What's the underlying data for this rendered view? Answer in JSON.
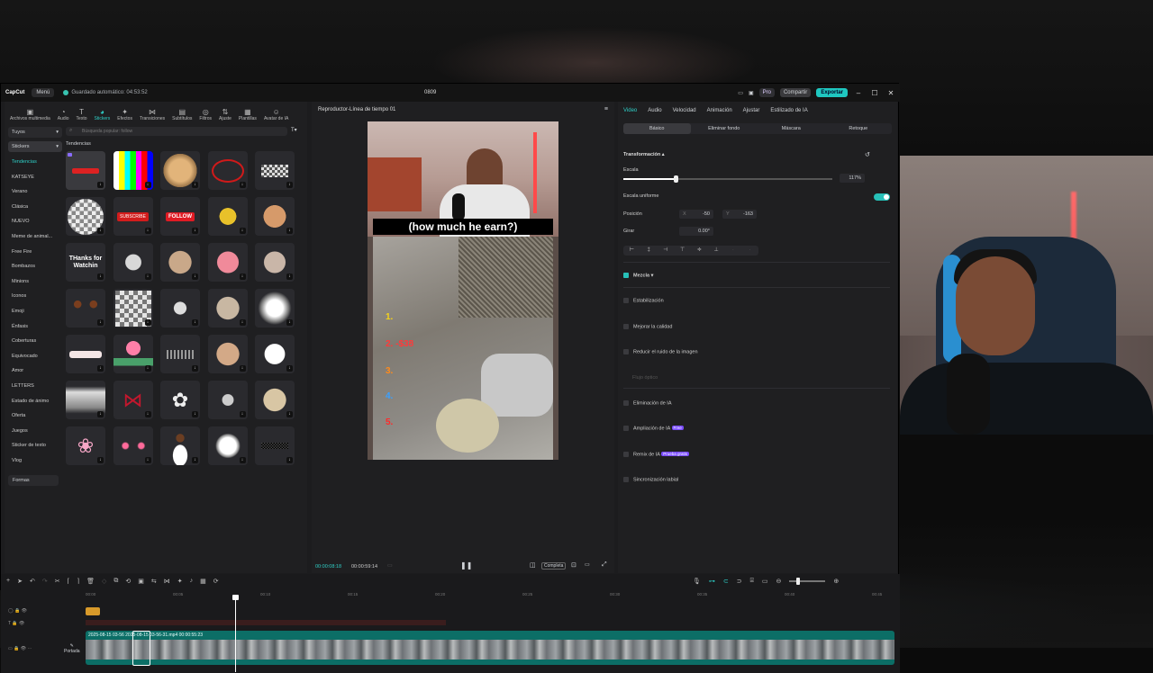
{
  "titlebar": {
    "app": "CapCut",
    "menu": "Menú",
    "autosave": "Guardado automático: 04:53:52",
    "project": "0809",
    "pro": "Pro",
    "share": "Compartir",
    "export": "Exportar"
  },
  "tools": [
    "Archivos multimedia",
    "Audio",
    "Texto",
    "Stickers",
    "Efectos",
    "Transiciones",
    "Subtítulos",
    "Filtros",
    "Ajuste",
    "Plantillas",
    "Avatar de IA"
  ],
  "active_tool": "Stickers",
  "left": {
    "dropdown1": "Tuyos",
    "dropdown2": "Stickers",
    "categories": [
      "Tendencias",
      "KATSEYE",
      "Verano",
      "Clásica",
      "NUEVO",
      "Meme de animal...",
      "Free Fire",
      "Bombazos",
      "Minions",
      "Iconos",
      "Emoji",
      "Énfasis",
      "Coberturas",
      "Equivocado",
      "Amor",
      "LETTERS",
      "Estado de ánimo",
      "Oferta",
      "Juegos",
      "Sticker de texto",
      "Vlog"
    ],
    "formas": "Formas",
    "search_placeholder": "Búsqueda popular: follow",
    "section": "Tendencias",
    "sticker_subscribe": "SUBSCRIBE",
    "sticker_follow": "FOLLOW",
    "sticker_thanks": "THanks for Watchin"
  },
  "player": {
    "title": "Reproductor-Línea de tiempo 01",
    "caption": "(how much he earn?)",
    "numbers": [
      "1.",
      "2. -$38",
      "3.",
      "4.",
      "5."
    ],
    "current_time": "00:00:08:18",
    "total_time": "00:00:59:14",
    "ratio_btn": "Completa"
  },
  "right": {
    "tabs": [
      "Video",
      "Audio",
      "Velocidad",
      "Animación",
      "Ajustar",
      "Estilizado de IA"
    ],
    "subtabs": [
      "Básico",
      "Eliminar fondo",
      "Máscara",
      "Retoque"
    ],
    "transform": "Transformación",
    "scale_label": "Escala",
    "scale_value": "117%",
    "scale_fraction": 0.24,
    "uniform_label": "Escala uniforme",
    "position_label": "Posición",
    "pos_x_label": "X",
    "pos_x": "-50",
    "pos_y_label": "Y",
    "pos_y": "-163",
    "rotate_label": "Girar",
    "rotate_value": "0.00°",
    "mix": "Mezcla",
    "options": [
      "Estabilización",
      "Mejorar la calidad",
      "Reducir el ruido de la imagen",
      "Eliminación de IA",
      "Ampliación de IA",
      "Remix de IA",
      "Sincronización labial"
    ],
    "faded_option": "Flujo óptico",
    "free_badge": "Free",
    "trial_badge": "Prueba gratis"
  },
  "timeline": {
    "ruler": [
      "00:00",
      "00:05",
      "00:10",
      "00:15",
      "00:20",
      "00:25",
      "00:30",
      "00:35",
      "00:40",
      "00:45"
    ],
    "clip_label": "2025-08-15 03-56   2025-08-15 03-56-31.mp4   00:00:55:23",
    "cover": "Portada"
  },
  "colors": {
    "accent": "#2fd0c8",
    "export": "#1fc7c0",
    "clip": "#0c6e66"
  }
}
